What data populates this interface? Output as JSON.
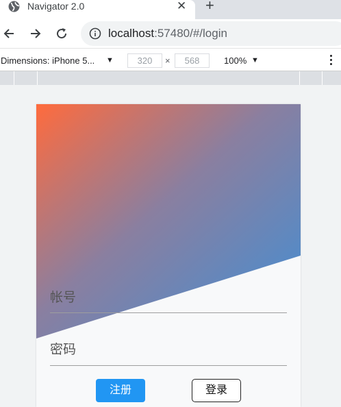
{
  "browser": {
    "tab_title": "Navigator 2.0",
    "close_glyph": "✕",
    "new_tab_glyph": "+",
    "url_host": "localhost",
    "url_rest": ":57480/#/login",
    "icons": [
      "globe-icon",
      "close-icon",
      "plus-icon",
      "back-arrow-icon",
      "forward-arrow-icon",
      "reload-icon",
      "info-icon"
    ]
  },
  "device_toolbar": {
    "dimensions_label": "Dimensions: iPhone 5...",
    "caret": "▼",
    "width_value": "320",
    "height_value": "568",
    "times": "×",
    "zoom": "100%",
    "icons": [
      "caret-down-icon",
      "kebab-menu-icon"
    ]
  },
  "app": {
    "gradient_colors": [
      "#ff6b3d",
      "#3f8fd6"
    ],
    "account_placeholder": "帐号",
    "password_placeholder": "密码",
    "register_label": "注册",
    "login_label": "登录",
    "primary_color": "#2196f3"
  }
}
